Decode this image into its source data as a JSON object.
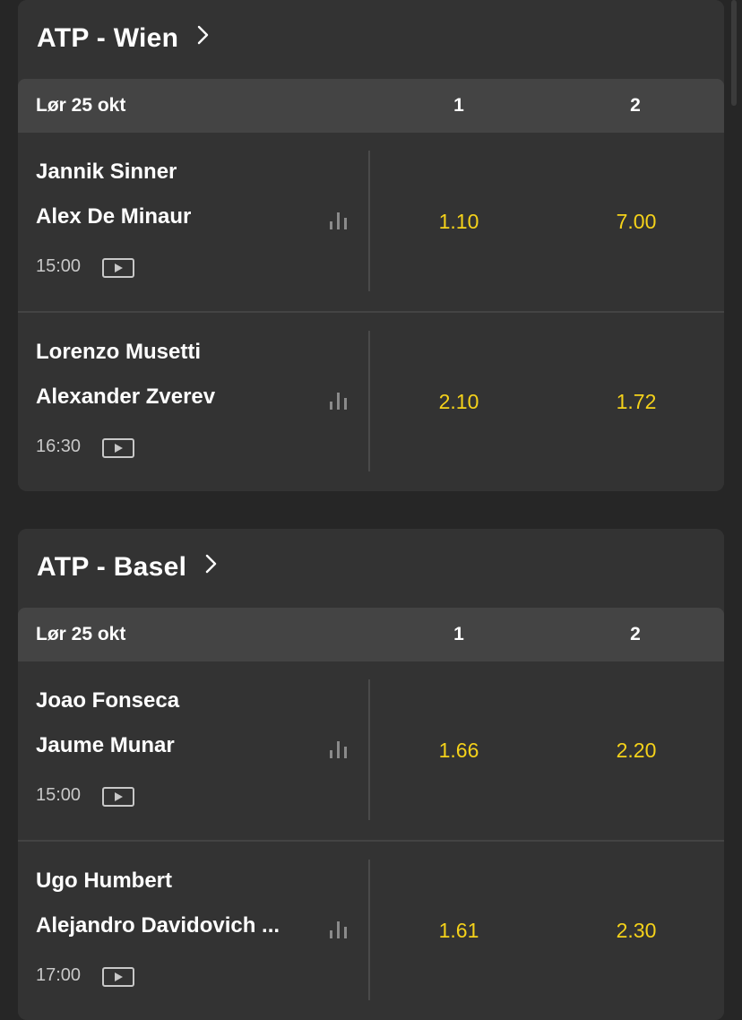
{
  "leagues": [
    {
      "title": "ATP - Wien",
      "date": "Lør 25 okt",
      "col1": "1",
      "col2": "2",
      "matches": [
        {
          "player1": "Jannik Sinner",
          "player2": "Alex De Minaur",
          "time": "15:00",
          "odd1": "1.10",
          "odd2": "7.00"
        },
        {
          "player1": "Lorenzo Musetti",
          "player2": "Alexander Zverev",
          "time": "16:30",
          "odd1": "2.10",
          "odd2": "1.72"
        }
      ]
    },
    {
      "title": "ATP - Basel",
      "date": "Lør 25 okt",
      "col1": "1",
      "col2": "2",
      "matches": [
        {
          "player1": "Joao Fonseca",
          "player2": "Jaume Munar",
          "time": "15:00",
          "odd1": "1.66",
          "odd2": "2.20"
        },
        {
          "player1": "Ugo Humbert",
          "player2": "Alejandro Davidovich ...",
          "time": "17:00",
          "odd1": "1.61",
          "odd2": "2.30"
        }
      ]
    }
  ],
  "colors": {
    "background": "#262626",
    "card": "#333333",
    "header_row": "#444444",
    "odds": "#f5d21a"
  },
  "icons": [
    "chevron-right-icon",
    "stats-icon",
    "play-icon"
  ]
}
